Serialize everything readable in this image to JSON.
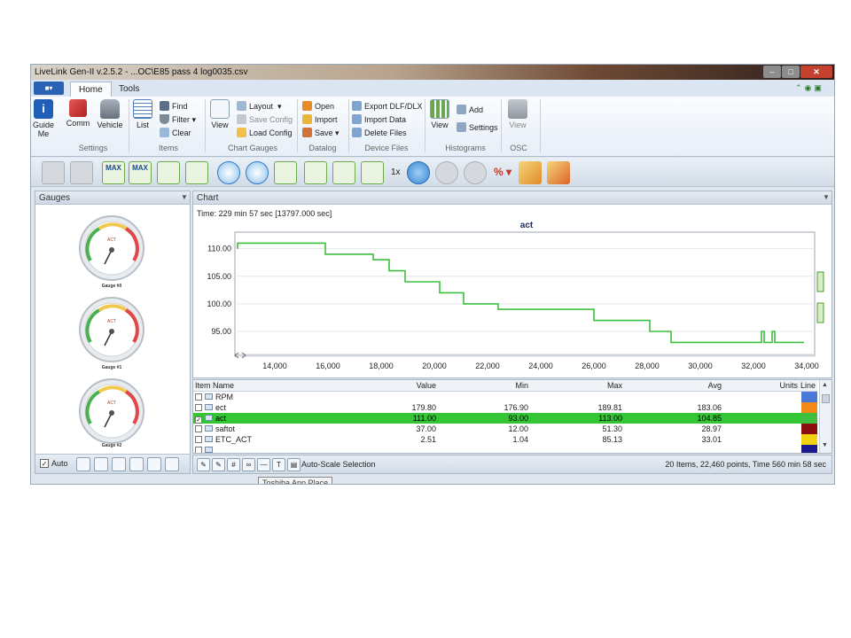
{
  "window": {
    "title": "LiveLink Gen-II  v.2.5.2 - ...OC\\E85 pass 4 log0035.csv"
  },
  "ribbon_tabs": [
    "Home",
    "Tools"
  ],
  "ribbon": {
    "settings": {
      "guide_me": "Guide\nMe",
      "comm": "Comm",
      "vehicle": "Vehicle",
      "label": "Settings"
    },
    "items": {
      "list": "List",
      "find": "Find",
      "filter": "Filter",
      "clear": "Clear",
      "label": "Items"
    },
    "chart_gauges": {
      "view": "View",
      "layout": "Layout",
      "save_config": "Save Config",
      "load_config": "Load Config",
      "label": "Chart  Gauges"
    },
    "datalog": {
      "open": "Open",
      "import": "Import",
      "save": "Save",
      "label": "Datalog"
    },
    "device_files": {
      "export": "Export DLF/DLX",
      "import_data": "Import Data",
      "delete_files": "Delete Files",
      "label": "Device Files"
    },
    "histograms": {
      "view": "View",
      "add": "Add",
      "settings": "Settings",
      "label": "Histograms"
    },
    "osc": {
      "view": "View",
      "label": "OSC"
    }
  },
  "toolbar": {
    "speed": "1x",
    "max_label": "MAX",
    "percent_label": "%"
  },
  "gauges_panel": {
    "title": "Gauges",
    "gauges": [
      {
        "name": "Gauge #0",
        "value_label": "ACT"
      },
      {
        "name": "Gauge #1",
        "value_label": "ACT"
      },
      {
        "name": "Gauge #2",
        "value_label": "ACT"
      }
    ],
    "auto_label": "Auto",
    "auto_checked": true
  },
  "chart_panel": {
    "title": "Chart",
    "time_readout": "Time: 229 min 57 sec [13797.000 sec]"
  },
  "chart_data": {
    "type": "line",
    "title": "act",
    "xlim": [
      12500,
      34300
    ],
    "ylim": [
      90.5,
      113.0
    ],
    "x_ticks": [
      "14,000",
      "16,000",
      "18,000",
      "20,000",
      "22,000",
      "24,000",
      "26,000",
      "28,000",
      "30,000",
      "32,000",
      "34,000"
    ],
    "y_ticks": [
      "110.00",
      "105.00",
      "100.00",
      "95.00"
    ],
    "series": [
      {
        "color": "#3fbf3f",
        "x": [
          12600,
          12600,
          15900,
          15900,
          17700,
          17700,
          18300,
          18300,
          18900,
          18900,
          20200,
          20200,
          21100,
          21100,
          22400,
          22400,
          26000,
          26000,
          28100,
          28100,
          28900,
          28900,
          32300,
          32300,
          32400,
          32400,
          32700,
          32700,
          32800,
          32800,
          33200,
          33200,
          33900
        ],
        "y": [
          110.0,
          111.0,
          111.0,
          109.0,
          109.0,
          108.0,
          108.0,
          106.0,
          106.0,
          104.0,
          104.0,
          102.0,
          102.0,
          100.0,
          100.0,
          99.0,
          99.0,
          97.0,
          97.0,
          95.0,
          95.0,
          93.0,
          93.0,
          95.0,
          95.0,
          93.0,
          93.0,
          95.0,
          95.0,
          93.0,
          93.0,
          93.0,
          93.0
        ]
      }
    ]
  },
  "table": {
    "headers": {
      "name": "Item Name",
      "value": "Value",
      "min": "Min",
      "max": "Max",
      "avg": "Avg",
      "units": "Units",
      "line": "Line"
    },
    "rows": [
      {
        "name": "RPM",
        "value": "",
        "min": "",
        "max": "",
        "avg": "",
        "checked": false,
        "color": "#4a78d4",
        "selected": false
      },
      {
        "name": "ect",
        "value": "179.80",
        "min": "176.90",
        "max": "189.81",
        "avg": "183.06",
        "checked": false,
        "color": "#f28a1a",
        "selected": false
      },
      {
        "name": "act",
        "value": "111.00",
        "min": "93.00",
        "max": "113.00",
        "avg": "104.85",
        "checked": true,
        "color": "#3fbf3f",
        "selected": true
      },
      {
        "name": "saftot",
        "value": "37.00",
        "min": "12.00",
        "max": "51.30",
        "avg": "28.97",
        "checked": false,
        "color": "#8b0f0f",
        "selected": false
      },
      {
        "name": "ETC_ACT",
        "value": "2.51",
        "min": "1.04",
        "max": "85.13",
        "avg": "33.01",
        "checked": false,
        "color": "#f2d20d",
        "selected": false
      },
      {
        "name": "",
        "value": "",
        "min": "",
        "max": "",
        "avg": "",
        "checked": false,
        "color": "#1a1a8c",
        "selected": false
      }
    ]
  },
  "bottom_bar": {
    "autoscale_label": "Auto-Scale Selection",
    "status": "20 Items, 22,460 points, Time 560 min 58 sec"
  },
  "taskbar_tooltip": "Toshiba App Place"
}
